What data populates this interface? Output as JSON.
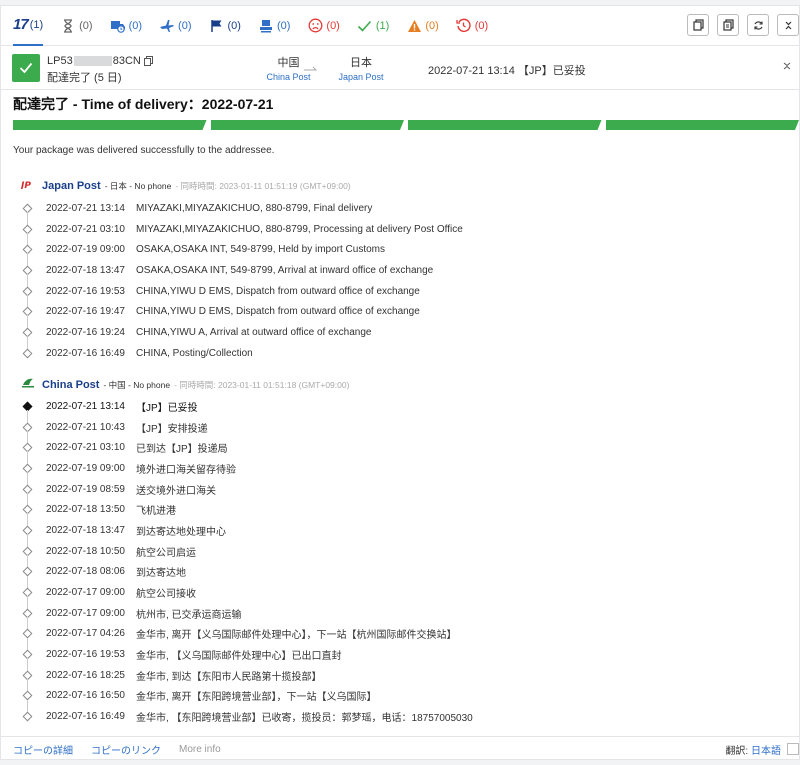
{
  "filters": [
    {
      "name": "all",
      "label": "17",
      "count": "(1)",
      "color": "#1a3f8a"
    },
    {
      "name": "not-found",
      "count": "(0)",
      "color": "#666666"
    },
    {
      "name": "info-received",
      "count": "(0)",
      "color": "#2e6fc7"
    },
    {
      "name": "in-transit",
      "count": "(0)",
      "color": "#2e6fc7"
    },
    {
      "name": "arrived",
      "count": "(0)",
      "color": "#1a3f8a"
    },
    {
      "name": "pick-up",
      "count": "(0)",
      "color": "#2e6fc7"
    },
    {
      "name": "undelivered",
      "count": "(0)",
      "color": "#e53935"
    },
    {
      "name": "delivered",
      "count": "(1)",
      "color": "#3cab4d"
    },
    {
      "name": "alert",
      "count": "(0)",
      "color": "#e67e22"
    },
    {
      "name": "expired",
      "count": "(0)",
      "color": "#e53935"
    }
  ],
  "package": {
    "tracking_prefix": "LP53",
    "tracking_suffix": "83CN",
    "status_sub": "配達完了 (5 日)",
    "from_country": "中国",
    "from_carrier": "China Post",
    "to_country": "日本",
    "to_carrier": "Japan Post",
    "latest_event": "2022-07-21 13:14 【JP】已妥投"
  },
  "delivery": {
    "title": "配達完了 - Time of delivery：2022-07-21",
    "description": "Your package was delivered successfully to the addressee."
  },
  "japan_post": {
    "name": "Japan Post",
    "meta": "- 日本 - No phone",
    "sync": "- 同時時間: 2023-01-11 01:51:19 (GMT+09:00)",
    "events": [
      {
        "time": "2022-07-21 13:14",
        "loc": "MIYAZAKI,MIYAZAKICHUO, 880-8799, Final delivery"
      },
      {
        "time": "2022-07-21 03:10",
        "loc": "MIYAZAKI,MIYAZAKICHUO, 880-8799, Processing at delivery Post Office"
      },
      {
        "time": "2022-07-19 09:00",
        "loc": "OSAKA,OSAKA INT, 549-8799, Held by import Customs"
      },
      {
        "time": "2022-07-18 13:47",
        "loc": "OSAKA,OSAKA INT, 549-8799, Arrival at inward office of exchange"
      },
      {
        "time": "2022-07-16 19:53",
        "loc": "CHINA,YIWU D EMS, Dispatch from outward office of exchange"
      },
      {
        "time": "2022-07-16 19:47",
        "loc": "CHINA,YIWU D EMS, Dispatch from outward office of exchange"
      },
      {
        "time": "2022-07-16 19:24",
        "loc": "CHINA,YIWU A, Arrival at outward office of exchange"
      },
      {
        "time": "2022-07-16 16:49",
        "loc": "CHINA, Posting/Collection"
      }
    ]
  },
  "china_post": {
    "name": "China Post",
    "meta": "- 中国 - No phone",
    "sync": "- 同時時間: 2023-01-11 01:51:18 (GMT+09:00)",
    "events": [
      {
        "time": "2022-07-21 13:14",
        "loc": "【JP】已妥投"
      },
      {
        "time": "2022-07-21 10:43",
        "loc": "【JP】安排投递"
      },
      {
        "time": "2022-07-21 03:10",
        "loc": "已到达【JP】投递局"
      },
      {
        "time": "2022-07-19 09:00",
        "loc": "境外进口海关留存待验"
      },
      {
        "time": "2022-07-19 08:59",
        "loc": "送交境外进口海关"
      },
      {
        "time": "2022-07-18 13:50",
        "loc": "飞机进港"
      },
      {
        "time": "2022-07-18 13:47",
        "loc": "到达寄达地处理中心"
      },
      {
        "time": "2022-07-18 10:50",
        "loc": "航空公司启运"
      },
      {
        "time": "2022-07-18 08:06",
        "loc": "到达寄达地"
      },
      {
        "time": "2022-07-17 09:00",
        "loc": "航空公司接收"
      },
      {
        "time": "2022-07-17 09:00",
        "loc": "杭州市, 已交承运商运输"
      },
      {
        "time": "2022-07-17 04:26",
        "loc": "金华市, 离开【义乌国际邮件处理中心】，下一站【杭州国际邮件交换站】"
      },
      {
        "time": "2022-07-16 19:53",
        "loc": "金华市, 【义乌国际邮件处理中心】已出口直封"
      },
      {
        "time": "2022-07-16 18:25",
        "loc": "金华市, 到达【东阳市人民路第十揽投部】"
      },
      {
        "time": "2022-07-16 16:50",
        "loc": "金华市, 离开【东阳跨境营业部】，下一站【义乌国际】"
      },
      {
        "time": "2022-07-16 16:49",
        "loc": "金华市, 【东阳跨境营业部】已收寄，揽投员：郭梦瑶，电话：18757005030"
      }
    ]
  },
  "footer": {
    "copy_details": "コピーの詳細",
    "copy_link": "コピーのリンク",
    "more_info": "More info",
    "translate_label": "翻訳:",
    "translate_lang": "日本語"
  }
}
